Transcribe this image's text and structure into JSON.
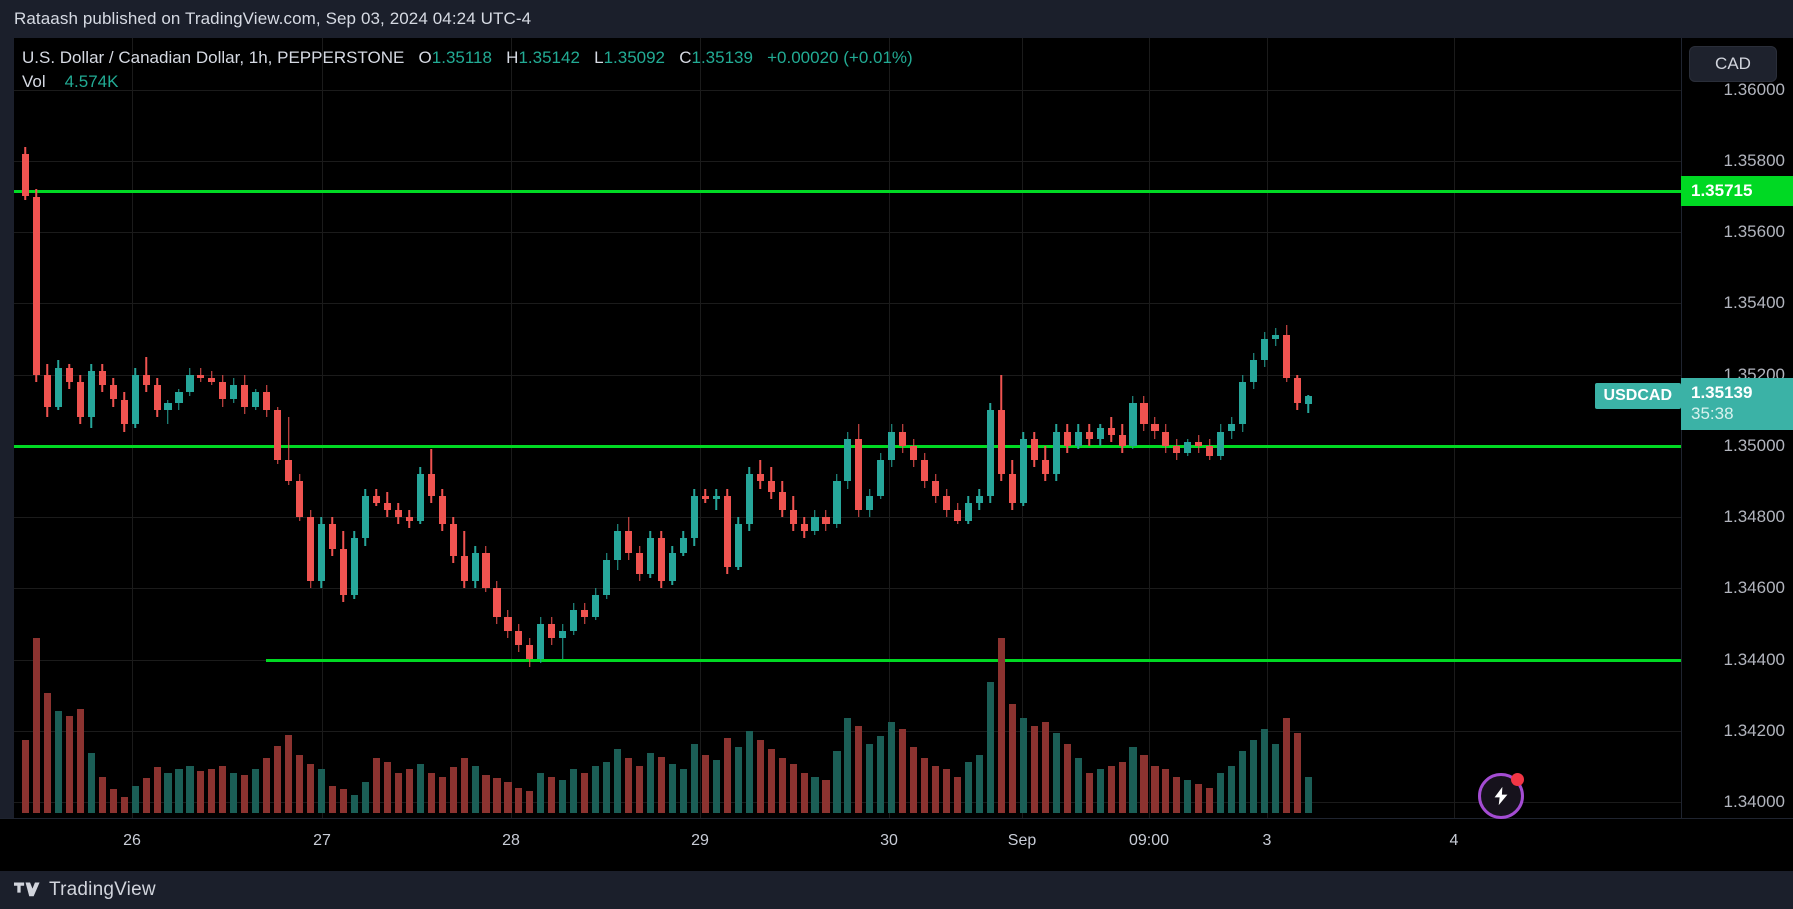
{
  "topbar": {
    "attribution": "Rataash published on TradingView.com, Sep 03, 2024 04:24 UTC-4"
  },
  "legend": {
    "symbol_line": "U.S. Dollar / Canadian Dollar, 1h, PEPPERSTONE",
    "o_label": "O",
    "o_value": "1.35118",
    "h_label": "H",
    "h_value": "1.35142",
    "l_label": "L",
    "l_value": "1.35092",
    "c_label": "C",
    "c_value": "1.35139",
    "change": "+0.00020 (+0.01%)",
    "vol_label": "Vol",
    "vol_value": "4.574K"
  },
  "toolbar": {
    "currency_button": "CAD"
  },
  "price_axis": {
    "labels": [
      "1.36000",
      "1.35800",
      "1.35600",
      "1.35400",
      "1.35200",
      "1.35000",
      "1.34800",
      "1.34600",
      "1.34400",
      "1.34200",
      "1.34000"
    ],
    "resistance_badge": "1.35715",
    "last_price": "1.35139",
    "countdown": "35:38",
    "symbol_pill": "USDCAD"
  },
  "time_axis": {
    "labels": [
      "26",
      "27",
      "28",
      "29",
      "30",
      "Sep",
      "09:00",
      "3",
      "4"
    ]
  },
  "footer": {
    "brand": "TradingView"
  },
  "colors": {
    "up": "#26a69a",
    "down": "#ef5350",
    "support_line": "#00d923",
    "last_price_badge": "#3bb2a6",
    "background": "#000000",
    "panel": "#1b1f2b",
    "text": "#d6dae3"
  },
  "chart_data": {
    "type": "candlestick",
    "title": "U.S. Dollar / Canadian Dollar, 1h, PEPPERSTONE",
    "symbol": "USDCAD",
    "exchange": "PEPPERSTONE",
    "interval": "1h",
    "xlabel": "",
    "ylabel": "",
    "ylim": [
      1.339,
      1.361
    ],
    "yticks": [
      1.36,
      1.358,
      1.356,
      1.354,
      1.352,
      1.35,
      1.348,
      1.346,
      1.344,
      1.342,
      1.34
    ],
    "xticks": [
      "26",
      "27",
      "28",
      "29",
      "30",
      "Sep",
      "09:00",
      "3",
      "4"
    ],
    "grid": true,
    "legend_position": "top-left",
    "horizontal_lines": [
      {
        "value": 1.35715,
        "color": "#00d923",
        "label": "1.35715",
        "span": "full"
      },
      {
        "value": 1.35,
        "color": "#00d923",
        "label": "",
        "span": "full"
      },
      {
        "value": 1.344,
        "color": "#00d923",
        "label": "",
        "span": "partial"
      }
    ],
    "last_price": 1.35139,
    "ohlc_current": {
      "open": 1.35118,
      "high": 1.35142,
      "low": 1.35092,
      "close": 1.35139
    },
    "volume_total": "4.574K",
    "candles": [
      {
        "o": 1.3582,
        "h": 1.3584,
        "l": 1.3569,
        "c": 1.357,
        "v": 0.4
      },
      {
        "o": 1.357,
        "h": 1.3572,
        "l": 1.3518,
        "c": 1.352,
        "v": 0.96
      },
      {
        "o": 1.352,
        "h": 1.3523,
        "l": 1.3508,
        "c": 1.3511,
        "v": 0.66
      },
      {
        "o": 1.3511,
        "h": 1.3524,
        "l": 1.351,
        "c": 1.3522,
        "v": 0.56
      },
      {
        "o": 1.3522,
        "h": 1.3523,
        "l": 1.3516,
        "c": 1.3518,
        "v": 0.53
      },
      {
        "o": 1.3518,
        "h": 1.352,
        "l": 1.3506,
        "c": 1.3508,
        "v": 0.57
      },
      {
        "o": 1.3508,
        "h": 1.3523,
        "l": 1.3505,
        "c": 1.3521,
        "v": 0.33
      },
      {
        "o": 1.3521,
        "h": 1.3523,
        "l": 1.3515,
        "c": 1.3517,
        "v": 0.2
      },
      {
        "o": 1.3517,
        "h": 1.3519,
        "l": 1.3511,
        "c": 1.3513,
        "v": 0.13
      },
      {
        "o": 1.3513,
        "h": 1.3515,
        "l": 1.3504,
        "c": 1.3506,
        "v": 0.09
      },
      {
        "o": 1.3506,
        "h": 1.3522,
        "l": 1.3505,
        "c": 1.352,
        "v": 0.15
      },
      {
        "o": 1.352,
        "h": 1.3525,
        "l": 1.3515,
        "c": 1.3517,
        "v": 0.19
      },
      {
        "o": 1.3517,
        "h": 1.3519,
        "l": 1.3508,
        "c": 1.351,
        "v": 0.25
      },
      {
        "o": 1.351,
        "h": 1.3513,
        "l": 1.3506,
        "c": 1.3512,
        "v": 0.22
      },
      {
        "o": 1.3512,
        "h": 1.3516,
        "l": 1.351,
        "c": 1.3515,
        "v": 0.24
      },
      {
        "o": 1.3515,
        "h": 1.3522,
        "l": 1.3514,
        "c": 1.352,
        "v": 0.26
      },
      {
        "o": 1.352,
        "h": 1.3522,
        "l": 1.3518,
        "c": 1.3519,
        "v": 0.23
      },
      {
        "o": 1.3519,
        "h": 1.3521,
        "l": 1.3517,
        "c": 1.3518,
        "v": 0.24
      },
      {
        "o": 1.3518,
        "h": 1.352,
        "l": 1.3511,
        "c": 1.3513,
        "v": 0.26
      },
      {
        "o": 1.3513,
        "h": 1.3519,
        "l": 1.3512,
        "c": 1.3517,
        "v": 0.22
      },
      {
        "o": 1.3517,
        "h": 1.352,
        "l": 1.3509,
        "c": 1.3511,
        "v": 0.21
      },
      {
        "o": 1.3511,
        "h": 1.3516,
        "l": 1.351,
        "c": 1.3515,
        "v": 0.24
      },
      {
        "o": 1.3515,
        "h": 1.3517,
        "l": 1.3508,
        "c": 1.351,
        "v": 0.3
      },
      {
        "o": 1.351,
        "h": 1.3511,
        "l": 1.3495,
        "c": 1.3496,
        "v": 0.37
      },
      {
        "o": 1.3496,
        "h": 1.3508,
        "l": 1.3489,
        "c": 1.349,
        "v": 0.43
      },
      {
        "o": 1.349,
        "h": 1.3492,
        "l": 1.3479,
        "c": 1.348,
        "v": 0.32
      },
      {
        "o": 1.348,
        "h": 1.3482,
        "l": 1.346,
        "c": 1.3462,
        "v": 0.27
      },
      {
        "o": 1.3462,
        "h": 1.348,
        "l": 1.346,
        "c": 1.3478,
        "v": 0.24
      },
      {
        "o": 1.3478,
        "h": 1.348,
        "l": 1.3469,
        "c": 1.3471,
        "v": 0.15
      },
      {
        "o": 1.3471,
        "h": 1.3476,
        "l": 1.3456,
        "c": 1.3458,
        "v": 0.13
      },
      {
        "o": 1.3458,
        "h": 1.3476,
        "l": 1.3457,
        "c": 1.3474,
        "v": 0.1
      },
      {
        "o": 1.3474,
        "h": 1.3488,
        "l": 1.3472,
        "c": 1.3486,
        "v": 0.17
      },
      {
        "o": 1.3486,
        "h": 1.3488,
        "l": 1.3483,
        "c": 1.3484,
        "v": 0.3
      },
      {
        "o": 1.3484,
        "h": 1.3487,
        "l": 1.348,
        "c": 1.3482,
        "v": 0.28
      },
      {
        "o": 1.3482,
        "h": 1.3484,
        "l": 1.3478,
        "c": 1.348,
        "v": 0.22
      },
      {
        "o": 1.348,
        "h": 1.3482,
        "l": 1.3477,
        "c": 1.3479,
        "v": 0.24
      },
      {
        "o": 1.3479,
        "h": 1.3494,
        "l": 1.3478,
        "c": 1.3492,
        "v": 0.27
      },
      {
        "o": 1.3492,
        "h": 1.3499,
        "l": 1.3484,
        "c": 1.3486,
        "v": 0.22
      },
      {
        "o": 1.3486,
        "h": 1.3488,
        "l": 1.3476,
        "c": 1.3478,
        "v": 0.2
      },
      {
        "o": 1.3478,
        "h": 1.348,
        "l": 1.3467,
        "c": 1.3469,
        "v": 0.25
      },
      {
        "o": 1.3469,
        "h": 1.3476,
        "l": 1.346,
        "c": 1.3462,
        "v": 0.3
      },
      {
        "o": 1.3462,
        "h": 1.3472,
        "l": 1.346,
        "c": 1.347,
        "v": 0.26
      },
      {
        "o": 1.347,
        "h": 1.3472,
        "l": 1.3459,
        "c": 1.346,
        "v": 0.21
      },
      {
        "o": 1.346,
        "h": 1.3462,
        "l": 1.345,
        "c": 1.3452,
        "v": 0.19
      },
      {
        "o": 1.3452,
        "h": 1.3454,
        "l": 1.3446,
        "c": 1.3448,
        "v": 0.17
      },
      {
        "o": 1.3448,
        "h": 1.345,
        "l": 1.3442,
        "c": 1.3444,
        "v": 0.14
      },
      {
        "o": 1.3444,
        "h": 1.3446,
        "l": 1.3438,
        "c": 1.344,
        "v": 0.12
      },
      {
        "o": 1.344,
        "h": 1.3452,
        "l": 1.3439,
        "c": 1.345,
        "v": 0.22
      },
      {
        "o": 1.345,
        "h": 1.3452,
        "l": 1.3444,
        "c": 1.3446,
        "v": 0.2
      },
      {
        "o": 1.3446,
        "h": 1.345,
        "l": 1.344,
        "c": 1.3448,
        "v": 0.18
      },
      {
        "o": 1.3448,
        "h": 1.3456,
        "l": 1.3447,
        "c": 1.3454,
        "v": 0.24
      },
      {
        "o": 1.3454,
        "h": 1.3456,
        "l": 1.345,
        "c": 1.3452,
        "v": 0.22
      },
      {
        "o": 1.3452,
        "h": 1.346,
        "l": 1.3451,
        "c": 1.3458,
        "v": 0.26
      },
      {
        "o": 1.3458,
        "h": 1.347,
        "l": 1.3457,
        "c": 1.3468,
        "v": 0.28
      },
      {
        "o": 1.3468,
        "h": 1.3478,
        "l": 1.3465,
        "c": 1.3476,
        "v": 0.35
      },
      {
        "o": 1.3476,
        "h": 1.348,
        "l": 1.3468,
        "c": 1.347,
        "v": 0.3
      },
      {
        "o": 1.347,
        "h": 1.3472,
        "l": 1.3462,
        "c": 1.3464,
        "v": 0.26
      },
      {
        "o": 1.3464,
        "h": 1.3476,
        "l": 1.3463,
        "c": 1.3474,
        "v": 0.33
      },
      {
        "o": 1.3474,
        "h": 1.3476,
        "l": 1.346,
        "c": 1.3462,
        "v": 0.31
      },
      {
        "o": 1.3462,
        "h": 1.3472,
        "l": 1.3461,
        "c": 1.347,
        "v": 0.27
      },
      {
        "o": 1.347,
        "h": 1.3476,
        "l": 1.3469,
        "c": 1.3474,
        "v": 0.24
      },
      {
        "o": 1.3474,
        "h": 1.3488,
        "l": 1.3472,
        "c": 1.3486,
        "v": 0.38
      },
      {
        "o": 1.3486,
        "h": 1.3488,
        "l": 1.3484,
        "c": 1.3485,
        "v": 0.32
      },
      {
        "o": 1.3485,
        "h": 1.3488,
        "l": 1.3482,
        "c": 1.3486,
        "v": 0.29
      },
      {
        "o": 1.3486,
        "h": 1.3488,
        "l": 1.3464,
        "c": 1.3466,
        "v": 0.41
      },
      {
        "o": 1.3466,
        "h": 1.348,
        "l": 1.3465,
        "c": 1.3478,
        "v": 0.36
      },
      {
        "o": 1.3478,
        "h": 1.3494,
        "l": 1.3476,
        "c": 1.3492,
        "v": 0.45
      },
      {
        "o": 1.3492,
        "h": 1.3496,
        "l": 1.3488,
        "c": 1.349,
        "v": 0.4
      },
      {
        "o": 1.349,
        "h": 1.3494,
        "l": 1.3485,
        "c": 1.3487,
        "v": 0.35
      },
      {
        "o": 1.3487,
        "h": 1.349,
        "l": 1.348,
        "c": 1.3482,
        "v": 0.3
      },
      {
        "o": 1.3482,
        "h": 1.3486,
        "l": 1.3476,
        "c": 1.3478,
        "v": 0.27
      },
      {
        "o": 1.3478,
        "h": 1.348,
        "l": 1.3474,
        "c": 1.3476,
        "v": 0.22
      },
      {
        "o": 1.3476,
        "h": 1.3482,
        "l": 1.3475,
        "c": 1.348,
        "v": 0.2
      },
      {
        "o": 1.348,
        "h": 1.3482,
        "l": 1.3476,
        "c": 1.3478,
        "v": 0.18
      },
      {
        "o": 1.3478,
        "h": 1.3492,
        "l": 1.3477,
        "c": 1.349,
        "v": 0.34
      },
      {
        "o": 1.349,
        "h": 1.3504,
        "l": 1.3488,
        "c": 1.3502,
        "v": 0.52
      },
      {
        "o": 1.3502,
        "h": 1.3506,
        "l": 1.348,
        "c": 1.3482,
        "v": 0.48
      },
      {
        "o": 1.3482,
        "h": 1.3488,
        "l": 1.348,
        "c": 1.3486,
        "v": 0.38
      },
      {
        "o": 1.3486,
        "h": 1.3498,
        "l": 1.3485,
        "c": 1.3496,
        "v": 0.42
      },
      {
        "o": 1.3496,
        "h": 1.3506,
        "l": 1.3494,
        "c": 1.3504,
        "v": 0.5
      },
      {
        "o": 1.3504,
        "h": 1.3506,
        "l": 1.3498,
        "c": 1.35,
        "v": 0.46
      },
      {
        "o": 1.35,
        "h": 1.3502,
        "l": 1.3494,
        "c": 1.3496,
        "v": 0.36
      },
      {
        "o": 1.3496,
        "h": 1.3498,
        "l": 1.3488,
        "c": 1.349,
        "v": 0.3
      },
      {
        "o": 1.349,
        "h": 1.3492,
        "l": 1.3484,
        "c": 1.3486,
        "v": 0.26
      },
      {
        "o": 1.3486,
        "h": 1.3488,
        "l": 1.348,
        "c": 1.3482,
        "v": 0.24
      },
      {
        "o": 1.3482,
        "h": 1.3484,
        "l": 1.3478,
        "c": 1.3479,
        "v": 0.2
      },
      {
        "o": 1.3479,
        "h": 1.3486,
        "l": 1.3478,
        "c": 1.3484,
        "v": 0.28
      },
      {
        "o": 1.3484,
        "h": 1.3488,
        "l": 1.3482,
        "c": 1.3486,
        "v": 0.32
      },
      {
        "o": 1.3486,
        "h": 1.3512,
        "l": 1.3484,
        "c": 1.351,
        "v": 0.72
      },
      {
        "o": 1.351,
        "h": 1.352,
        "l": 1.349,
        "c": 1.3492,
        "v": 0.96
      },
      {
        "o": 1.3492,
        "h": 1.3496,
        "l": 1.3482,
        "c": 1.3484,
        "v": 0.6
      },
      {
        "o": 1.3484,
        "h": 1.3504,
        "l": 1.3483,
        "c": 1.3502,
        "v": 0.52
      },
      {
        "o": 1.3502,
        "h": 1.3504,
        "l": 1.3494,
        "c": 1.3496,
        "v": 0.48
      },
      {
        "o": 1.3496,
        "h": 1.35,
        "l": 1.349,
        "c": 1.3492,
        "v": 0.5
      },
      {
        "o": 1.3492,
        "h": 1.3506,
        "l": 1.349,
        "c": 1.3504,
        "v": 0.44
      },
      {
        "o": 1.3504,
        "h": 1.3506,
        "l": 1.3498,
        "c": 1.35,
        "v": 0.38
      },
      {
        "o": 1.35,
        "h": 1.3506,
        "l": 1.3499,
        "c": 1.3504,
        "v": 0.3
      },
      {
        "o": 1.3504,
        "h": 1.3506,
        "l": 1.35,
        "c": 1.3502,
        "v": 0.22
      },
      {
        "o": 1.3502,
        "h": 1.3506,
        "l": 1.35,
        "c": 1.3505,
        "v": 0.24
      },
      {
        "o": 1.3505,
        "h": 1.3508,
        "l": 1.3501,
        "c": 1.3503,
        "v": 0.26
      },
      {
        "o": 1.3503,
        "h": 1.3506,
        "l": 1.3498,
        "c": 1.35,
        "v": 0.28
      },
      {
        "o": 1.35,
        "h": 1.3514,
        "l": 1.3499,
        "c": 1.3512,
        "v": 0.36
      },
      {
        "o": 1.3512,
        "h": 1.3514,
        "l": 1.3504,
        "c": 1.3506,
        "v": 0.32
      },
      {
        "o": 1.3506,
        "h": 1.3508,
        "l": 1.3502,
        "c": 1.3504,
        "v": 0.26
      },
      {
        "o": 1.3504,
        "h": 1.3506,
        "l": 1.3498,
        "c": 1.35,
        "v": 0.24
      },
      {
        "o": 1.35,
        "h": 1.3502,
        "l": 1.3496,
        "c": 1.3498,
        "v": 0.2
      },
      {
        "o": 1.3498,
        "h": 1.3502,
        "l": 1.3497,
        "c": 1.3501,
        "v": 0.18
      },
      {
        "o": 1.3501,
        "h": 1.3503,
        "l": 1.3498,
        "c": 1.35,
        "v": 0.16
      },
      {
        "o": 1.35,
        "h": 1.3502,
        "l": 1.3496,
        "c": 1.3497,
        "v": 0.14
      },
      {
        "o": 1.3497,
        "h": 1.3506,
        "l": 1.3496,
        "c": 1.3504,
        "v": 0.22
      },
      {
        "o": 1.3504,
        "h": 1.3508,
        "l": 1.3502,
        "c": 1.3506,
        "v": 0.26
      },
      {
        "o": 1.3506,
        "h": 1.352,
        "l": 1.3504,
        "c": 1.3518,
        "v": 0.34
      },
      {
        "o": 1.3518,
        "h": 1.3526,
        "l": 1.3516,
        "c": 1.3524,
        "v": 0.4
      },
      {
        "o": 1.3524,
        "h": 1.3532,
        "l": 1.3522,
        "c": 1.353,
        "v": 0.46
      },
      {
        "o": 1.353,
        "h": 1.3533,
        "l": 1.3528,
        "c": 1.3531,
        "v": 0.38
      },
      {
        "o": 1.3531,
        "h": 1.3534,
        "l": 1.3518,
        "c": 1.3519,
        "v": 0.52
      },
      {
        "o": 1.3519,
        "h": 1.352,
        "l": 1.351,
        "c": 1.3512,
        "v": 0.44
      },
      {
        "o": 1.35118,
        "h": 1.35142,
        "l": 1.35092,
        "c": 1.35139,
        "v": 0.2
      }
    ]
  }
}
